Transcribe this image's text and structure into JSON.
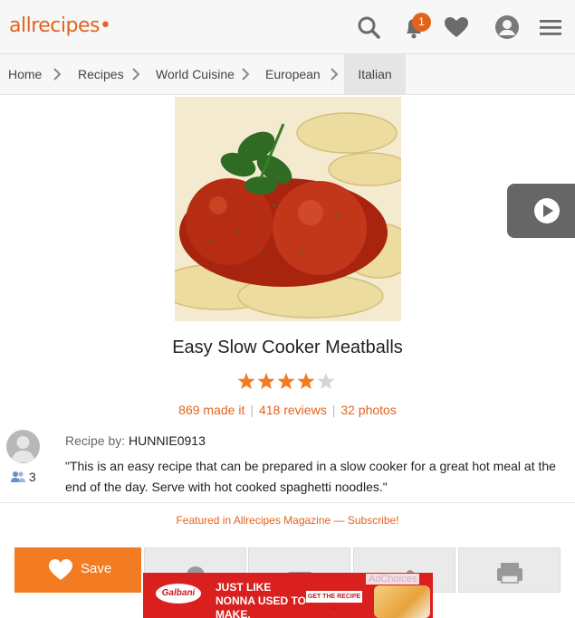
{
  "header": {
    "logo_text": "allrecipes",
    "notification_count": "1",
    "icons": [
      "search-icon",
      "bell-icon",
      "heart-icon",
      "user-icon",
      "menu-icon"
    ]
  },
  "breadcrumb": {
    "items": [
      "Home",
      "Recipes",
      "World Cuisine",
      "European"
    ],
    "current": "Italian"
  },
  "recipe": {
    "title": "Easy Slow Cooker Meatballs",
    "rating": 4,
    "rating_max": 5,
    "made_it": "869 made it",
    "reviews": "418 reviews",
    "photos": "32 photos",
    "author_label": "Recipe by:",
    "author_name": "HUNNIE0913",
    "followers": "3",
    "description": "\"This is an easy recipe that can be prepared in a slow cooker for a great hot meal at the end of the day. Serve with hot cooked spaghetti noodles.\"",
    "featured": "Featured in Allrecipes Magazine — Subscribe!"
  },
  "actions": {
    "save_label": "Save"
  },
  "ad": {
    "brand": "Galbani",
    "headline": "JUST LIKE NONNA USED TO MAKE.",
    "cta": "GET THE RECIPE ▶",
    "ad_choices": "AdChoices"
  },
  "colors": {
    "accent": "#e5621c",
    "save_button": "#f37c22",
    "star": "#f37c22",
    "star_empty": "#d5d5d5",
    "ad_background": "#d9201f"
  }
}
